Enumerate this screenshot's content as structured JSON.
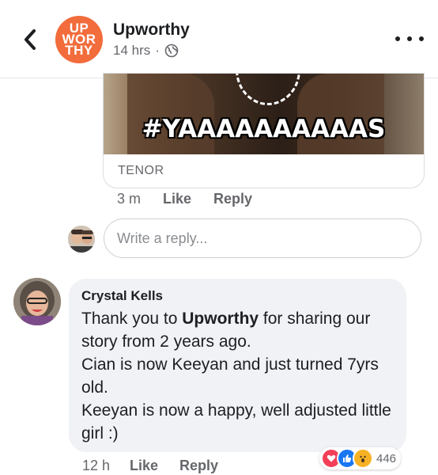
{
  "header": {
    "page_name": "Upworthy",
    "logo_lines": [
      "UP",
      "WOR",
      "THY"
    ],
    "post_time": "14 hrs",
    "separator": "·"
  },
  "gif": {
    "caption": "#YAAAAAAAAAAS",
    "provider": "TENOR"
  },
  "gif_comment_actions": {
    "time": "3 m",
    "like": "Like",
    "reply": "Reply"
  },
  "reply_box": {
    "placeholder": "Write a reply..."
  },
  "comment": {
    "author": "Crystal Kells",
    "text_before": "Thank you to ",
    "mention": "Upworthy",
    "text_after": " for sharing our story from 2 years ago.",
    "line2": "Cian is now Keeyan and just turned 7yrs old.",
    "line3": "Keeyan is now a happy, well adjusted little girl  :)",
    "time": "12 h",
    "like": "Like",
    "reply": "Reply",
    "reaction_count": "446",
    "reactions": [
      "love",
      "like",
      "wow"
    ]
  },
  "colors": {
    "brand_orange": "#f26c3c",
    "like_blue": "#1877f2",
    "love_red": "#f33e58",
    "wow_yellow": "#f7b125",
    "bubble_bg": "#f0f2f5"
  }
}
